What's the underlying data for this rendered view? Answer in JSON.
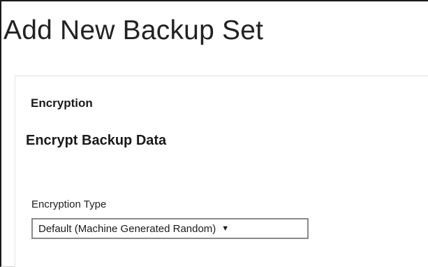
{
  "page": {
    "title": "Add New Backup Set"
  },
  "panel": {
    "section_title": "Encryption",
    "sub_title": "Encrypt Backup Data",
    "encryption_type": {
      "label": "Encryption Type",
      "selected": "Default (Machine Generated Random)",
      "arrow_icon": "▼"
    }
  },
  "colors": {
    "text": "#1a1a1a",
    "border": "#8a8a8a",
    "panel_border": "#e4e4e4"
  }
}
